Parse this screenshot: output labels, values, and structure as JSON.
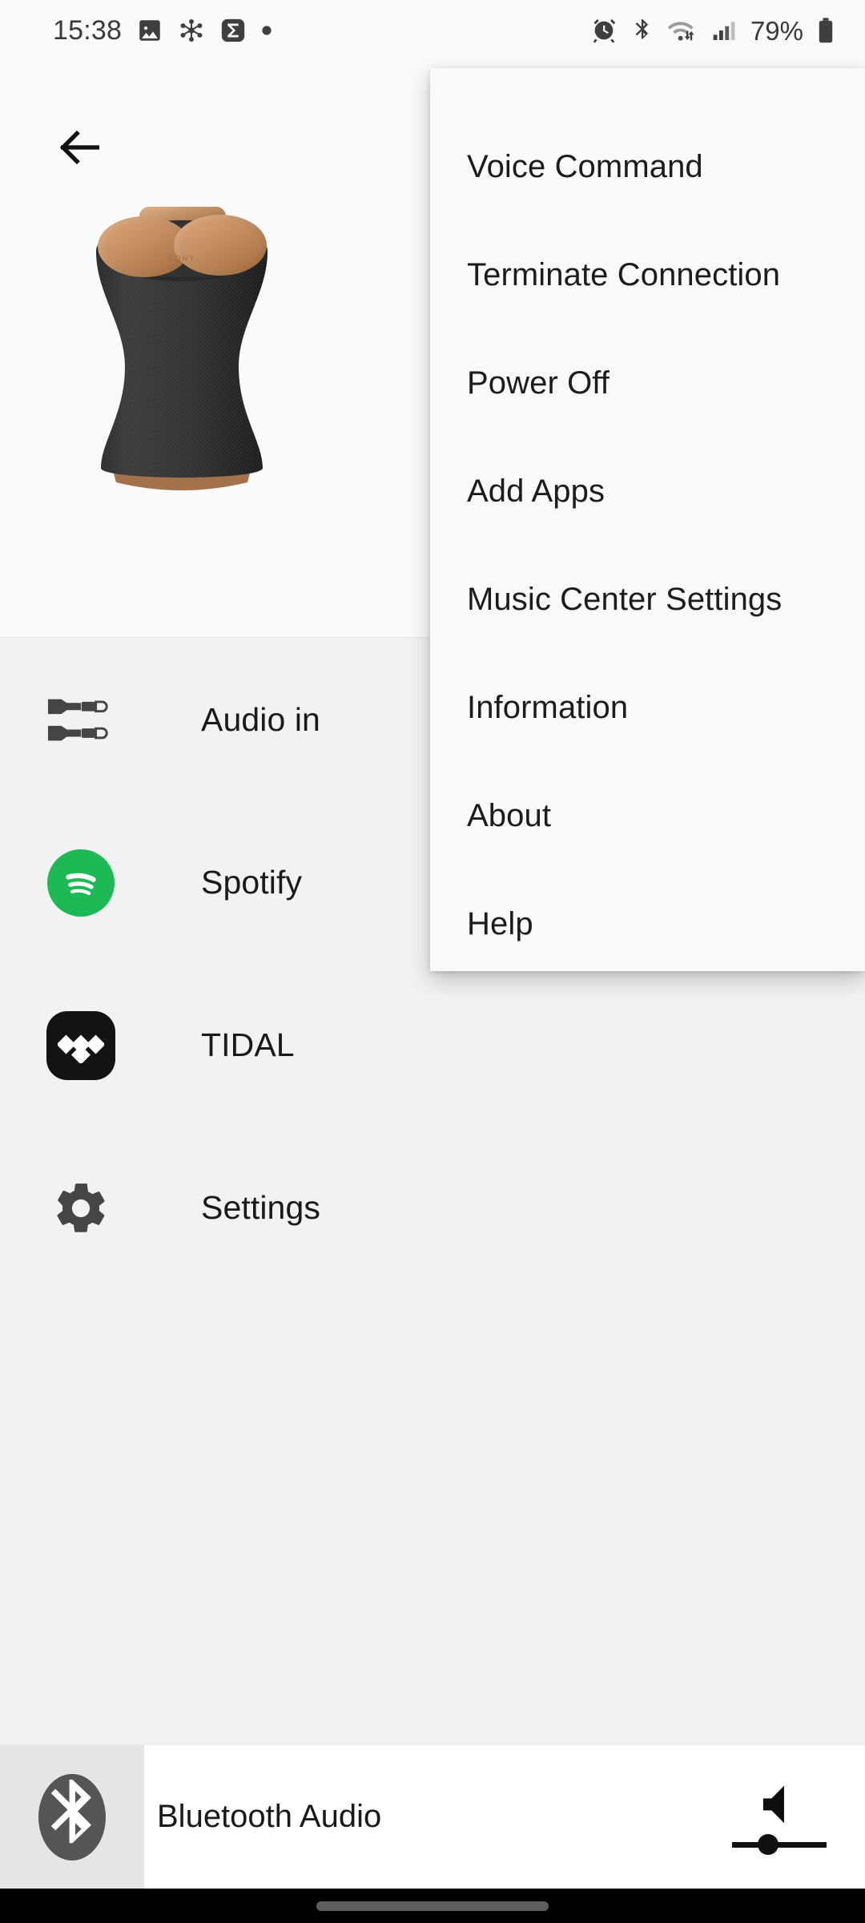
{
  "status_bar": {
    "clock": "15:38",
    "battery_percent": "79%",
    "left_icons": [
      "gallery-icon",
      "cluster-icon",
      "sigma-badge-icon",
      "dot-icon"
    ],
    "right_icons": [
      "alarm-icon",
      "bluetooth-icon",
      "wifi-transfer-icon",
      "signal-bars-icon",
      "battery-icon"
    ]
  },
  "hero": {
    "back_icon": "arrow-left-icon",
    "device_image_alt": "Sony wireless speaker",
    "brand_text": "SONY"
  },
  "app_list": [
    {
      "label": "Audio in",
      "icon": "audio-plug-icon"
    },
    {
      "label": "Spotify",
      "icon": "spotify-icon"
    },
    {
      "label": "TIDAL",
      "icon": "tidal-icon"
    },
    {
      "label": "Settings",
      "icon": "gear-icon"
    }
  ],
  "overflow_menu": {
    "items": [
      {
        "label": "Voice Command"
      },
      {
        "label": "Terminate Connection"
      },
      {
        "label": "Power Off"
      },
      {
        "label": "Add Apps"
      },
      {
        "label": "Music Center Settings"
      },
      {
        "label": "Information"
      },
      {
        "label": "About"
      },
      {
        "label": "Help"
      }
    ]
  },
  "now_playing": {
    "source_icon": "bluetooth-icon",
    "title": "Bluetooth Audio",
    "volume_icon": "speaker-volume-icon",
    "volume_level": 38
  },
  "colors": {
    "spotify_green": "#1DB954",
    "tidal_black": "#131313",
    "page_bg": "#f2f2f2",
    "hero_bg": "#fafafa",
    "menu_bg": "#f9f9f9",
    "nav_bar": "#000000"
  }
}
